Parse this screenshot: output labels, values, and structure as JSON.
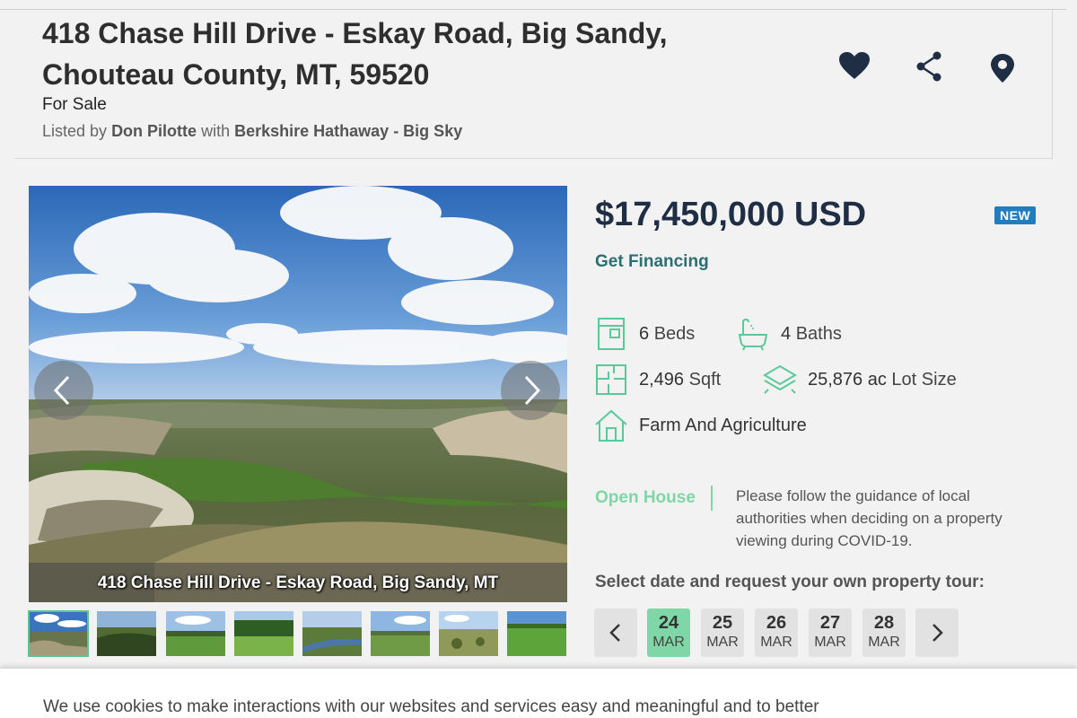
{
  "listing": {
    "title": "418 Chase Hill Drive - Eskay Road, Big Sandy, Chouteau County, MT, 59520",
    "status": "For Sale",
    "listed_by_prefix": "Listed by",
    "agent": "Don Pilotte",
    "with_word": "with",
    "brokerage": "Berkshire Hathaway - Big Sky"
  },
  "actions": {
    "favorite_icon": "heart-icon",
    "share_icon": "share-icon",
    "map_icon": "map-pin-icon"
  },
  "gallery": {
    "caption": "418 Chase Hill Drive - Eskay Road, Big Sandy, MT",
    "thumbnail_count": 8,
    "active_thumbnail": 1
  },
  "pricing": {
    "price": "$17,450,000 USD",
    "badge": "NEW",
    "financing_link": "Get Financing"
  },
  "features": {
    "beds_num": "6",
    "beds_label": "Beds",
    "baths_num": "4",
    "baths_label": "Baths",
    "sqft_num": "2,496",
    "sqft_label": "Sqft",
    "lot_num": "25,876 ac",
    "lot_label": "Lot Size",
    "type": "Farm And Agriculture"
  },
  "open_house": {
    "label": "Open House",
    "note": "Please follow the guidance of local authorities when deciding on a property viewing during COVID-19."
  },
  "tour": {
    "label": "Select date and request your own property tour:",
    "dates": [
      {
        "day": "24",
        "month": "MAR"
      },
      {
        "day": "25",
        "month": "MAR"
      },
      {
        "day": "26",
        "month": "MAR"
      },
      {
        "day": "27",
        "month": "MAR"
      },
      {
        "day": "28",
        "month": "MAR"
      }
    ]
  },
  "cookie_banner": {
    "text": "We use cookies to make interactions with our websites and services easy and meaningful and to better"
  },
  "colors": {
    "price": "#1f2e45",
    "accent_green": "#7fd6a6",
    "badge_blue": "#1e7ec0",
    "financing": "#2c6e72"
  }
}
